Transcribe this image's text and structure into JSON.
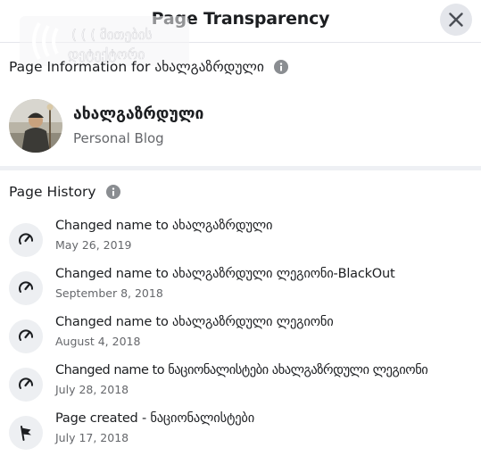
{
  "header": {
    "title": "Page Transparency",
    "close_icon": "close-icon"
  },
  "watermark": {
    "line1": "( ( ( მითების",
    "line2": "დეტექტორი"
  },
  "page_info": {
    "title": "Page Information for ახალგაზრდული",
    "page_name": "ახალგაზრდული",
    "category": "Personal Blog"
  },
  "history": {
    "title": "Page History",
    "items": [
      {
        "text": "Changed name to ახალგაზრდული",
        "date": "May 26, 2019",
        "icon": "rename-icon"
      },
      {
        "text": "Changed name to ახალგაზრდული ლეგიონი-BlackOut",
        "date": "September 8, 2018",
        "icon": "rename-icon"
      },
      {
        "text": "Changed name to ახალგაზრდული ლეგიონი",
        "date": "August 4, 2018",
        "icon": "rename-icon"
      },
      {
        "text": "Changed name to ნაციონალისტები ახალგაზრდული ლეგიონი",
        "date": "July 28, 2018",
        "icon": "rename-icon"
      },
      {
        "text": "Page created - ნაციონალისტები",
        "date": "July 17, 2018",
        "icon": "flag-icon"
      }
    ]
  },
  "colors": {
    "secondary_text": "#65676b",
    "icon_bg": "#edeff2",
    "divider": "#eef0f4"
  }
}
